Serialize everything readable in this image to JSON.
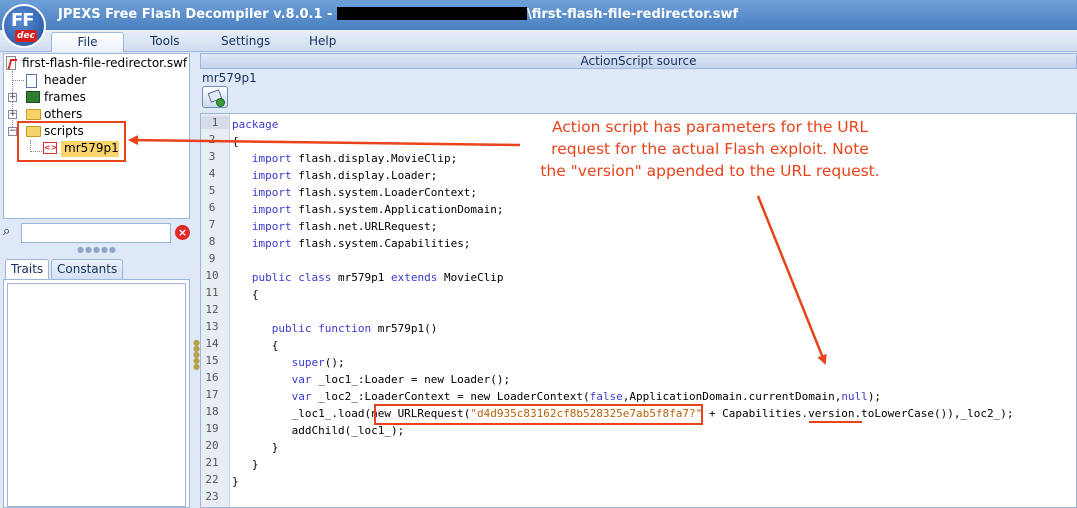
{
  "window": {
    "title_prefix": "JPEXS Free Flash Decompiler v.8.0.1 - ",
    "title_suffix": "\\first-flash-file-redirector.swf",
    "logo_text": "FF",
    "logo_sub": "dec"
  },
  "menu": {
    "items": [
      {
        "label": "File",
        "active": true
      },
      {
        "label": "Tools",
        "active": false
      },
      {
        "label": "Settings",
        "active": false
      },
      {
        "label": "Help",
        "active": false
      }
    ]
  },
  "tree": {
    "root": "first-flash-file-redirector.swf",
    "nodes": [
      {
        "label": "header",
        "icon": "file-icon"
      },
      {
        "label": "frames",
        "icon": "film-icon"
      },
      {
        "label": "others",
        "icon": "folder-icon"
      },
      {
        "label": "scripts",
        "icon": "folder-open-icon"
      }
    ],
    "selected_script": "mr579p1"
  },
  "tabs": [
    {
      "label": "Traits",
      "active": true
    },
    {
      "label": "Constants",
      "active": false
    }
  ],
  "source_panel": {
    "header": "ActionScript source",
    "script_name": "mr579p1"
  },
  "code": {
    "line_numbers": [
      "1",
      "2",
      "3",
      "4",
      "5",
      "6",
      "7",
      "8",
      "9",
      "10",
      "11",
      "12",
      "13",
      "14",
      "15",
      "16",
      "17",
      "18",
      "19",
      "20",
      "21",
      "22",
      "23"
    ],
    "current_line": 1
  },
  "annotation": {
    "line1": "Action script has parameters for the URL",
    "line2": "request for the actual Flash exploit.  Note",
    "line3": "the \"version\" appended to the URL request.",
    "color": "#e8431b"
  }
}
